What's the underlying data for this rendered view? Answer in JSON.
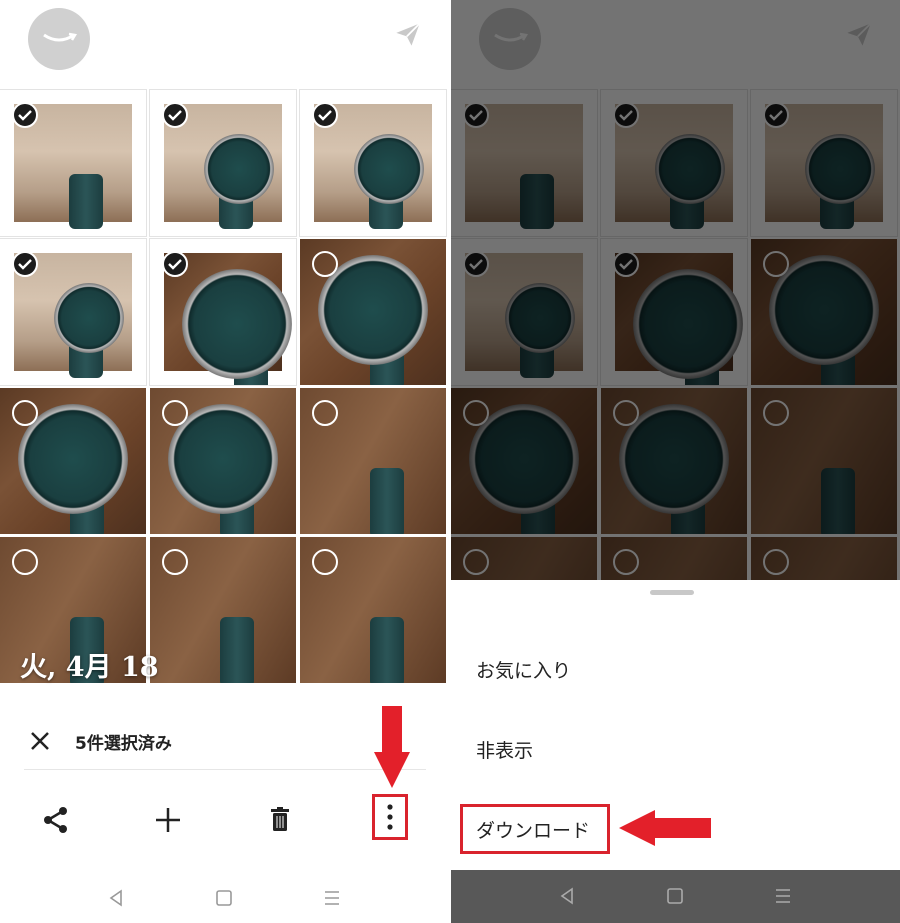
{
  "left": {
    "selection_count_label": "5件選択済み",
    "date_header": "火, 4月 18",
    "grid": [
      {
        "selected": true,
        "scene": "arm"
      },
      {
        "selected": true,
        "scene": "arm"
      },
      {
        "selected": true,
        "scene": "arm"
      },
      {
        "selected": true,
        "scene": "arm"
      },
      {
        "selected": true,
        "scene": "wood"
      },
      {
        "selected": false,
        "scene": "wood"
      },
      {
        "selected": false,
        "scene": "wood"
      },
      {
        "selected": false,
        "scene": "wood2"
      },
      {
        "selected": false,
        "scene": "wood2"
      },
      {
        "selected": false,
        "scene": "wood2"
      },
      {
        "selected": false,
        "scene": "wood2"
      },
      {
        "selected": false,
        "scene": "wood2"
      }
    ],
    "actions": [
      "share-icon",
      "plus-icon",
      "trash-icon",
      "more-vertical-icon"
    ],
    "nav": [
      "back-icon",
      "home-icon",
      "menu-icon"
    ]
  },
  "right": {
    "menu": {
      "favorite": "お気に入り",
      "hide": "非表示",
      "download": "ダウンロード"
    },
    "nav": [
      "back-icon",
      "home-icon",
      "menu-icon"
    ]
  },
  "colors": {
    "highlight": "#d9232d",
    "dim_overlay": "rgba(0,0,0,0.55)",
    "check_fill": "#1c1c1c"
  }
}
